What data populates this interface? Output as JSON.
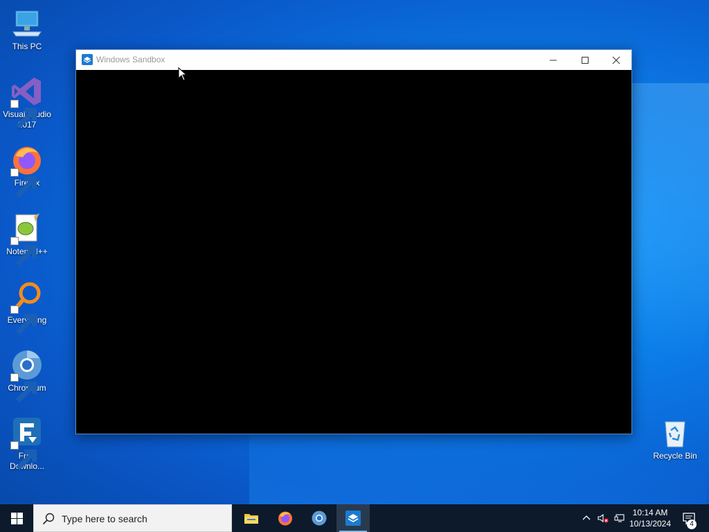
{
  "desktop": {
    "icons": [
      {
        "label": "This PC",
        "icon": "this-pc-icon"
      },
      {
        "label": "Visual Studio 2017",
        "icon": "visual-studio-icon"
      },
      {
        "label": "Firefox",
        "icon": "firefox-icon"
      },
      {
        "label": "Notepad++",
        "icon": "notepadpp-icon"
      },
      {
        "label": "Everything",
        "icon": "everything-icon"
      },
      {
        "label": "Chromium",
        "icon": "chromium-icon"
      },
      {
        "label": "Free Downlo...",
        "icon": "free-download-manager-icon"
      },
      {
        "label": "Recycle Bin",
        "icon": "recycle-bin-icon"
      }
    ]
  },
  "window": {
    "title": "Windows Sandbox",
    "icon": "windows-sandbox-icon",
    "content_color": "#000000"
  },
  "taskbar": {
    "search_placeholder": "Type here to search",
    "apps": [
      {
        "name": "File Explorer",
        "icon": "file-explorer-icon"
      },
      {
        "name": "Firefox",
        "icon": "firefox-icon"
      },
      {
        "name": "Chromium",
        "icon": "chromium-icon"
      },
      {
        "name": "Windows Sandbox",
        "icon": "windows-sandbox-icon",
        "active": true
      }
    ],
    "clock": {
      "time": "10:14 AM",
      "date": "10/13/2024"
    },
    "notification_count": "4"
  },
  "colors": {
    "taskbar_bg": "#0c1a2c",
    "accent": "#76b9ed",
    "desktop_blue": "#0b7ae6"
  }
}
